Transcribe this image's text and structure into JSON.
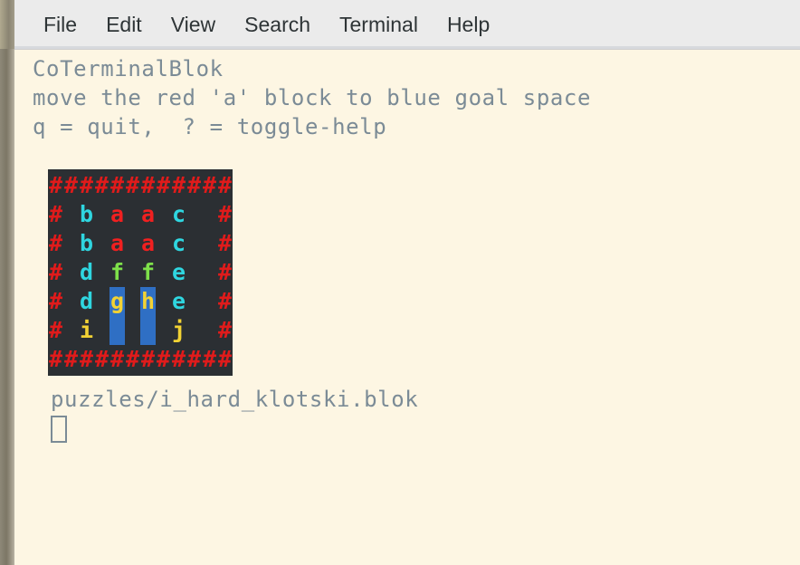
{
  "window": {
    "title": "CoTerminalBlok"
  },
  "menubar": {
    "items": [
      {
        "label": "File",
        "name": "menu-file"
      },
      {
        "label": "Edit",
        "name": "menu-edit"
      },
      {
        "label": "View",
        "name": "menu-view"
      },
      {
        "label": "Search",
        "name": "menu-search"
      },
      {
        "label": "Terminal",
        "name": "menu-terminal"
      },
      {
        "label": "Help",
        "name": "menu-help"
      }
    ]
  },
  "terminal": {
    "header_lines": [
      "CoTerminalBlok",
      "move the red 'a' block to blue goal space",
      "q = quit,  ? = toggle-help"
    ],
    "file_path": "puzzles/i_hard_klotski.blok",
    "cursor": "block-cursor"
  },
  "colors": {
    "background": "#fdf6e3",
    "foreground": "#7b8b96",
    "menubar_bg": "#ebebeb",
    "grid_bg": "#2b2f33",
    "wall": "#e01b1b",
    "block_a": "#f02020",
    "block_cyan": "#2fd6e0",
    "block_green": "#7ee04a",
    "block_yellow": "#f2d234",
    "goal": "#2f6fc4"
  },
  "board": {
    "rows": 7,
    "cols": 12,
    "legend": {
      "wall": "#",
      "a": "red 2x2 block",
      "b": "cyan vertical block",
      "c": "cyan vertical block",
      "d": "cyan vertical block",
      "e": "cyan vertical block",
      "f": "green single block",
      "g": "yellow single block",
      "h": "yellow single block",
      "i": "yellow single block",
      "j": "yellow single block",
      "goal": "blue goal space"
    },
    "grid": [
      [
        {
          "ch": "#",
          "color": "wall"
        },
        {
          "ch": "#",
          "color": "wall"
        },
        {
          "ch": "#",
          "color": "wall"
        },
        {
          "ch": "#",
          "color": "wall"
        },
        {
          "ch": "#",
          "color": "wall"
        },
        {
          "ch": "#",
          "color": "wall"
        },
        {
          "ch": "#",
          "color": "wall"
        },
        {
          "ch": "#",
          "color": "wall"
        },
        {
          "ch": "#",
          "color": "wall"
        },
        {
          "ch": "#",
          "color": "wall"
        },
        {
          "ch": "#",
          "color": "wall"
        },
        {
          "ch": "#",
          "color": "wall"
        }
      ],
      [
        {
          "ch": "#",
          "color": "wall"
        },
        {
          "ch": " ",
          "color": "blank"
        },
        {
          "ch": "b",
          "color": "cyan"
        },
        {
          "ch": " ",
          "color": "blank"
        },
        {
          "ch": "a",
          "color": "red"
        },
        {
          "ch": " ",
          "color": "blank"
        },
        {
          "ch": "a",
          "color": "red"
        },
        {
          "ch": " ",
          "color": "blank"
        },
        {
          "ch": "c",
          "color": "cyan"
        },
        {
          "ch": " ",
          "color": "blank"
        },
        {
          "ch": " ",
          "color": "blank"
        },
        {
          "ch": "#",
          "color": "wall"
        }
      ],
      [
        {
          "ch": "#",
          "color": "wall"
        },
        {
          "ch": " ",
          "color": "blank"
        },
        {
          "ch": "b",
          "color": "cyan"
        },
        {
          "ch": " ",
          "color": "blank"
        },
        {
          "ch": "a",
          "color": "red"
        },
        {
          "ch": " ",
          "color": "blank"
        },
        {
          "ch": "a",
          "color": "red"
        },
        {
          "ch": " ",
          "color": "blank"
        },
        {
          "ch": "c",
          "color": "cyan"
        },
        {
          "ch": " ",
          "color": "blank"
        },
        {
          "ch": " ",
          "color": "blank"
        },
        {
          "ch": "#",
          "color": "wall"
        }
      ],
      [
        {
          "ch": "#",
          "color": "wall"
        },
        {
          "ch": " ",
          "color": "blank"
        },
        {
          "ch": "d",
          "color": "cyan"
        },
        {
          "ch": " ",
          "color": "blank"
        },
        {
          "ch": "f",
          "color": "green"
        },
        {
          "ch": " ",
          "color": "blank"
        },
        {
          "ch": "f",
          "color": "green"
        },
        {
          "ch": " ",
          "color": "blank"
        },
        {
          "ch": "e",
          "color": "cyan"
        },
        {
          "ch": " ",
          "color": "blank"
        },
        {
          "ch": " ",
          "color": "blank"
        },
        {
          "ch": "#",
          "color": "wall"
        }
      ],
      [
        {
          "ch": "#",
          "color": "wall"
        },
        {
          "ch": " ",
          "color": "blank"
        },
        {
          "ch": "d",
          "color": "cyan"
        },
        {
          "ch": " ",
          "color": "blank"
        },
        {
          "ch": "g",
          "color": "yellow",
          "goal": true
        },
        {
          "ch": " ",
          "color": "blank"
        },
        {
          "ch": "h",
          "color": "yellow",
          "goal": true
        },
        {
          "ch": " ",
          "color": "blank"
        },
        {
          "ch": "e",
          "color": "cyan"
        },
        {
          "ch": " ",
          "color": "blank"
        },
        {
          "ch": " ",
          "color": "blank"
        },
        {
          "ch": "#",
          "color": "wall"
        }
      ],
      [
        {
          "ch": "#",
          "color": "wall"
        },
        {
          "ch": " ",
          "color": "blank"
        },
        {
          "ch": "i",
          "color": "yellow"
        },
        {
          "ch": " ",
          "color": "blank"
        },
        {
          "ch": " ",
          "color": "blank",
          "goal": true
        },
        {
          "ch": " ",
          "color": "blank"
        },
        {
          "ch": " ",
          "color": "blank",
          "goal": true
        },
        {
          "ch": " ",
          "color": "blank"
        },
        {
          "ch": "j",
          "color": "yellow"
        },
        {
          "ch": " ",
          "color": "blank"
        },
        {
          "ch": " ",
          "color": "blank"
        },
        {
          "ch": "#",
          "color": "wall"
        }
      ],
      [
        {
          "ch": "#",
          "color": "wall"
        },
        {
          "ch": "#",
          "color": "wall"
        },
        {
          "ch": "#",
          "color": "wall"
        },
        {
          "ch": "#",
          "color": "wall"
        },
        {
          "ch": "#",
          "color": "wall"
        },
        {
          "ch": "#",
          "color": "wall"
        },
        {
          "ch": "#",
          "color": "wall"
        },
        {
          "ch": "#",
          "color": "wall"
        },
        {
          "ch": "#",
          "color": "wall"
        },
        {
          "ch": "#",
          "color": "wall"
        },
        {
          "ch": "#",
          "color": "wall"
        },
        {
          "ch": "#",
          "color": "wall"
        }
      ]
    ]
  }
}
